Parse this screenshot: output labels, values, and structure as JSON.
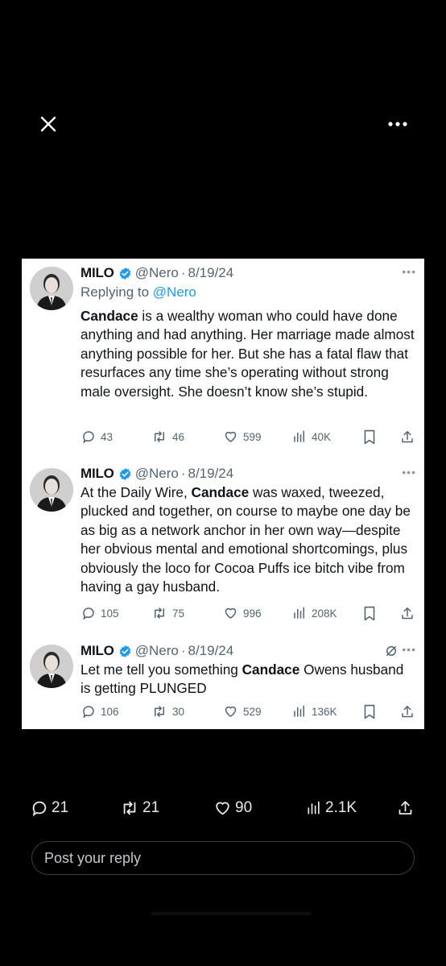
{
  "viewer": {
    "close_icon": "close-icon",
    "more_icon": "more-horizontal-icon"
  },
  "tweets": [
    {
      "name": "MILO",
      "handle": "@Nero",
      "dot": "·",
      "date": "8/19/24",
      "replying_prefix": "Replying to ",
      "replying_to": "@Nero",
      "text_html": "<b>Candace</b> is a wealthy woman who could have done anything and had anything. Her marriage made almost anything possible for her. But she has a fatal flaw that resurfaces any time she’s operating without strong male oversight. She doesn’t know she’s stupid.",
      "replies": "43",
      "retweets": "46",
      "likes": "599",
      "views": "40K"
    },
    {
      "name": "MILO",
      "handle": "@Nero",
      "dot": "·",
      "date": "8/19/24",
      "text_html": "At the Daily Wire, <b>Candace</b> was waxed, tweezed, plucked and together, on course to maybe one day be as big as a network anchor in her own way—despite her obvious mental and emotional shortcomings, plus obviously the loco for Cocoa Puffs ice bitch vibe from having a gay husband.",
      "replies": "105",
      "retweets": "75",
      "likes": "996",
      "views": "208K"
    },
    {
      "name": "MILO",
      "handle": "@Nero",
      "dot": "·",
      "date": "8/19/24",
      "text_html": "Let me tell you something <b>Candace</b> Owens husband is getting PLUNGED",
      "replies": "106",
      "retweets": "30",
      "likes": "529",
      "views": "136K"
    }
  ],
  "post_stats": {
    "replies": "21",
    "retweets": "21",
    "likes": "90",
    "views": "2.1K"
  },
  "reply_box": {
    "placeholder": "Post your reply"
  },
  "colors": {
    "background": "#000000",
    "tweet_bg": "#ffffff",
    "link": "#1d9bf0",
    "verified": "#1d9bf0",
    "secondary_text": "#536471"
  }
}
